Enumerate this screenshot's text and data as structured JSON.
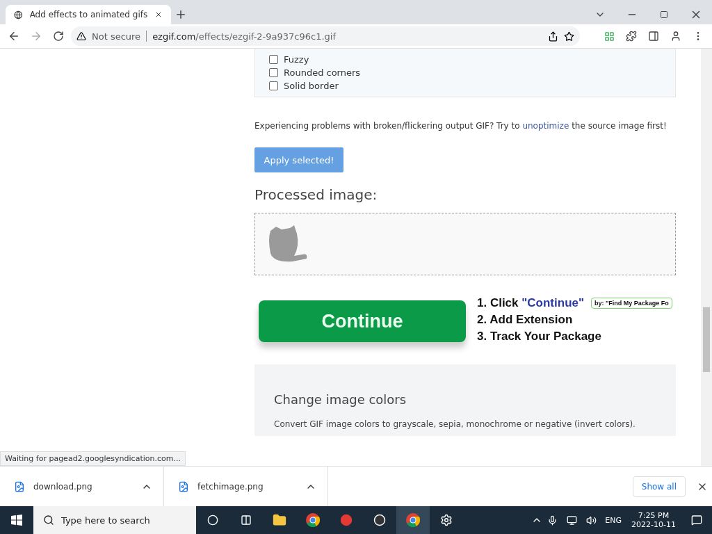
{
  "browser": {
    "tab": {
      "title": "Add effects to animated gifs",
      "selected": true
    },
    "security": "Not secure",
    "url_host": "ezgif.com",
    "url_path": "/effects/ezgif-2-9a937c96c1.gif"
  },
  "effects": [
    {
      "label": "Fuzzy",
      "checked": false
    },
    {
      "label": "Rounded corners",
      "checked": false
    },
    {
      "label": "Solid border",
      "checked": false
    }
  ],
  "notice": {
    "before": "Experiencing problems with broken/flickering output GIF? Try to ",
    "link": "unoptimize",
    "after": " the source image first!"
  },
  "apply_button": "Apply selected!",
  "processed_heading": "Processed image:",
  "ad": {
    "button": "Continue",
    "steps": [
      {
        "text": "1. Click ",
        "highlight": "\"Continue\""
      },
      {
        "text": "2. Add Extension"
      },
      {
        "text": "3. Track Your Package"
      }
    ],
    "badge": "by: \"Find My Package Fo"
  },
  "section": {
    "title": "Change image colors",
    "text": "Convert GIF image colors to grayscale, sepia, monochrome or negative (invert colors)."
  },
  "status": "Waiting for pagead2.googlesyndication.com...",
  "downloads": [
    {
      "name": "download.png"
    },
    {
      "name": "fetchimage.png"
    }
  ],
  "show_all": "Show all",
  "taskbar": {
    "search_placeholder": "Type here to search",
    "language": "ENG",
    "time": "7:25 PM",
    "date": "2022-10-11"
  }
}
